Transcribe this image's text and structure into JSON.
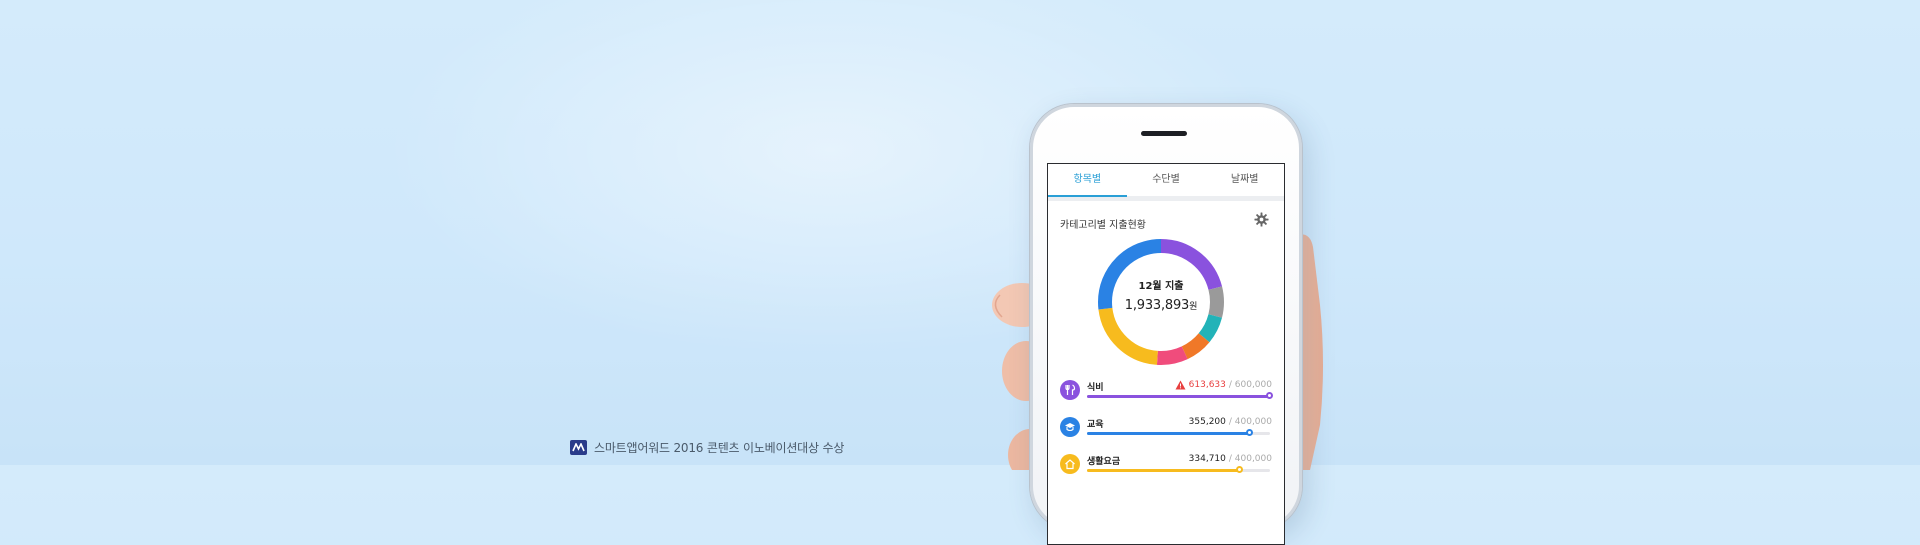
{
  "award": {
    "text": "스마트앱어워드 2016 콘텐츠 이노베이션대상 수상"
  },
  "tabs": [
    {
      "label": "항목별",
      "active": true
    },
    {
      "label": "수단별",
      "active": false
    },
    {
      "label": "날짜별",
      "active": false
    }
  ],
  "section_title": "카테고리별 지출현황",
  "donut": {
    "label": "12월 지출",
    "amount": "1,933,893",
    "unit": "원",
    "segments": [
      {
        "color": "#8a52de",
        "value": 0.21
      },
      {
        "color": "#9a9a9a",
        "value": 0.08
      },
      {
        "color": "#22b3b8",
        "value": 0.07
      },
      {
        "color": "#f07828",
        "value": 0.07
      },
      {
        "color": "#f04c7c",
        "value": 0.08
      },
      {
        "color": "#f7bb1e",
        "value": 0.22
      },
      {
        "color": "#2a82e4",
        "value": 0.27
      }
    ]
  },
  "categories": [
    {
      "name": "식비",
      "amount": "613,633",
      "budget": "/ 600,000",
      "over": true,
      "fill": 1.0,
      "color": "#8a52de",
      "icon": "fork-spoon-icon"
    },
    {
      "name": "교육",
      "amount": "355,200",
      "budget": "/ 400,000",
      "over": false,
      "fill": 0.888,
      "color": "#2a82e4",
      "icon": "graduation-cap-icon"
    },
    {
      "name": "생활요금",
      "amount": "334,710",
      "budget": "/ 400,000",
      "over": false,
      "fill": 0.837,
      "color": "#f7bb1e",
      "icon": "house-icon"
    }
  ]
}
